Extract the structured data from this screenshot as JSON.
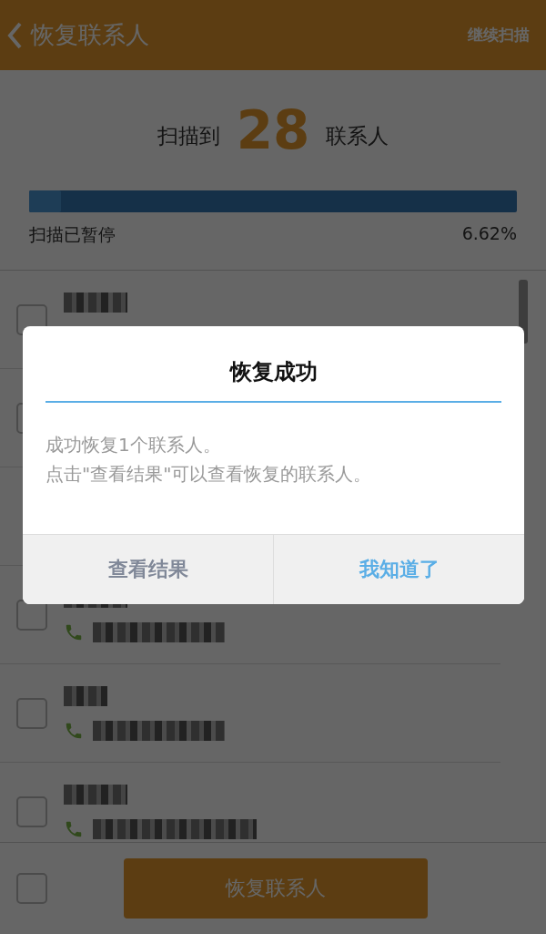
{
  "header": {
    "title": "恢复联系人",
    "action": "继续扫描"
  },
  "scan": {
    "prefix": "扫描到",
    "count": "28",
    "suffix": "联系人",
    "level": 0.0662,
    "status": "扫描已暂停",
    "percent": "6.62%"
  },
  "contacts": [
    {
      "kind": "name",
      "checked": false
    },
    {
      "kind": "blank",
      "checked": false
    },
    {
      "kind": "hidden"
    },
    {
      "kind": "full",
      "checked": false
    },
    {
      "kind": "full",
      "checked": false
    },
    {
      "kind": "full",
      "checked": false
    }
  ],
  "footer": {
    "select_all_checked": false,
    "button": "恢复联系人"
  },
  "dialog": {
    "title": "恢复成功",
    "lines": [
      "成功恢复1个联系人。",
      "点击\"查看结果\"可以查看恢复的联系人。"
    ],
    "buttons": [
      {
        "label": "查看结果",
        "kind": "secondary"
      },
      {
        "label": "我知道了",
        "kind": "primary"
      }
    ]
  }
}
